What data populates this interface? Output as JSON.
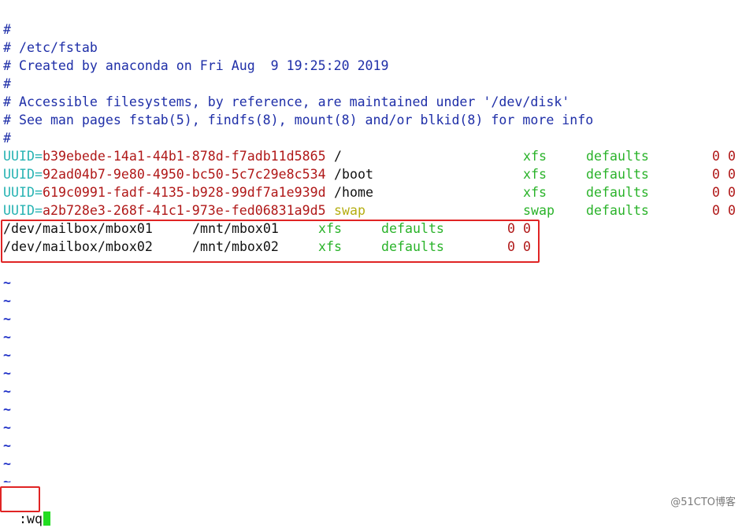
{
  "comments": [
    "#",
    "# /etc/fstab",
    "# Created by anaconda on Fri Aug  9 19:25:20 2019",
    "#",
    "# Accessible filesystems, by reference, are maintained under '/dev/disk'",
    "# See man pages fstab(5), findfs(8), mount(8) and/or blkid(8) for more info",
    "#"
  ],
  "uuid_entries": [
    {
      "key": "UUID",
      "eq": "=",
      "uuid": "b39ebede-14a1-44b1-878d-f7adb11d5865",
      "mount": "/",
      "type": "xfs",
      "options": "defaults",
      "dump": "0",
      "pass": "0"
    },
    {
      "key": "UUID",
      "eq": "=",
      "uuid": "92ad04b7-9e80-4950-bc50-5c7c29e8c534",
      "mount": "/boot",
      "type": "xfs",
      "options": "defaults",
      "dump": "0",
      "pass": "0"
    },
    {
      "key": "UUID",
      "eq": "=",
      "uuid": "619c0991-fadf-4135-b928-99df7a1e939d",
      "mount": "/home",
      "type": "xfs",
      "options": "defaults",
      "dump": "0",
      "pass": "0"
    },
    {
      "key": "UUID",
      "eq": "=",
      "uuid": "a2b728e3-268f-41c1-973e-fed06831a9d5",
      "mount": "swap",
      "type": "swap",
      "options": "defaults",
      "dump": "0",
      "pass": "0"
    }
  ],
  "mailbox_entries": [
    {
      "device": "/dev/mailbox/mbox01",
      "mount": "/mnt/mbox01",
      "type": "xfs",
      "options": "defaults",
      "dump": "0",
      "pass": "0"
    },
    {
      "device": "/dev/mailbox/mbox02",
      "mount": "/mnt/mbox02",
      "type": "xfs",
      "options": "defaults",
      "dump": "0",
      "pass": "0"
    }
  ],
  "tildes": [
    "~",
    "~",
    "~",
    "~",
    "~",
    "~",
    "~",
    "~",
    "~",
    "~",
    "~",
    "~"
  ],
  "command": ":wq",
  "watermark": "@51CTO博客",
  "colors": {
    "comment": "#1f2fa8",
    "uuid_key": "#27b3b3",
    "uuid_value": "#b01818",
    "fs_type": "#2ab32a",
    "swap_mount": "#b5ae12",
    "highlight_box": "#e02424",
    "cursor": "#22dd22"
  }
}
